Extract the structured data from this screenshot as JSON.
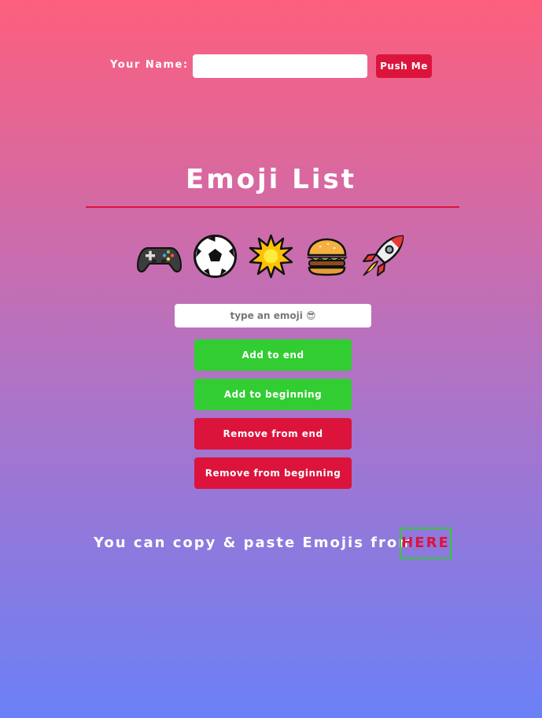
{
  "name_form": {
    "label": "Your Name:",
    "input_value": "",
    "button_label": "Push Me"
  },
  "emoji_section": {
    "title": "Emoji List",
    "emojis": [
      {
        "char": "🎮",
        "icon": "game-controller-icon"
      },
      {
        "char": "⚽",
        "icon": "soccer-ball-icon"
      },
      {
        "char": "💥",
        "icon": "explosion-icon"
      },
      {
        "char": "🍔",
        "icon": "hamburger-icon"
      },
      {
        "char": "🚀",
        "icon": "rocket-icon"
      }
    ],
    "input_placeholder": "type an emoji 😎",
    "buttons": {
      "add_end": "Add to end",
      "add_beginning": "Add to beginning",
      "remove_end": "Remove from end",
      "remove_beginning": "Remove from beginning"
    }
  },
  "footer": {
    "copy_text": "You can copy & paste Emojis from",
    "link_label": "HERE"
  },
  "colors": {
    "gradient_top": "#fd5f7d",
    "gradient_bottom": "#6b80f7",
    "accent_red": "#dc143c",
    "accent_green": "#32cd32"
  }
}
